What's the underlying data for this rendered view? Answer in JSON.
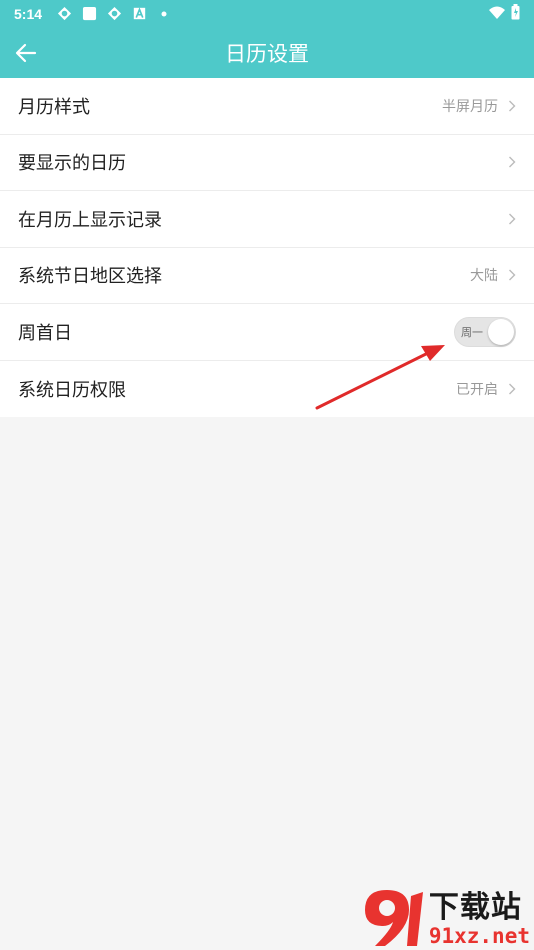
{
  "status_bar": {
    "time": "5:14",
    "icons": [
      "sync-icon",
      "square-icon",
      "sync-icon",
      "a-box-icon",
      "dot-icon"
    ],
    "right_icons": [
      "wifi-icon",
      "battery-icon"
    ]
  },
  "app_bar": {
    "title": "日历设置",
    "back_icon": "back-arrow-icon"
  },
  "settings": {
    "items": [
      {
        "label": "月历样式",
        "value": "半屏月历"
      },
      {
        "label": "要显示的日历",
        "value": ""
      },
      {
        "label": "在月历上显示记录",
        "value": ""
      },
      {
        "label": "系统节日地区选择",
        "value": "大陆"
      },
      {
        "label": "周首日",
        "toggle_text": "周一"
      },
      {
        "label": "系统日历权限",
        "value": "已开启"
      }
    ]
  },
  "watermark": {
    "cn": "下载站",
    "url": "91xz.net"
  },
  "colors": {
    "primary": "#4ec9c9",
    "annotation_arrow": "#e02a2a",
    "watermark_red": "#e8332f"
  }
}
